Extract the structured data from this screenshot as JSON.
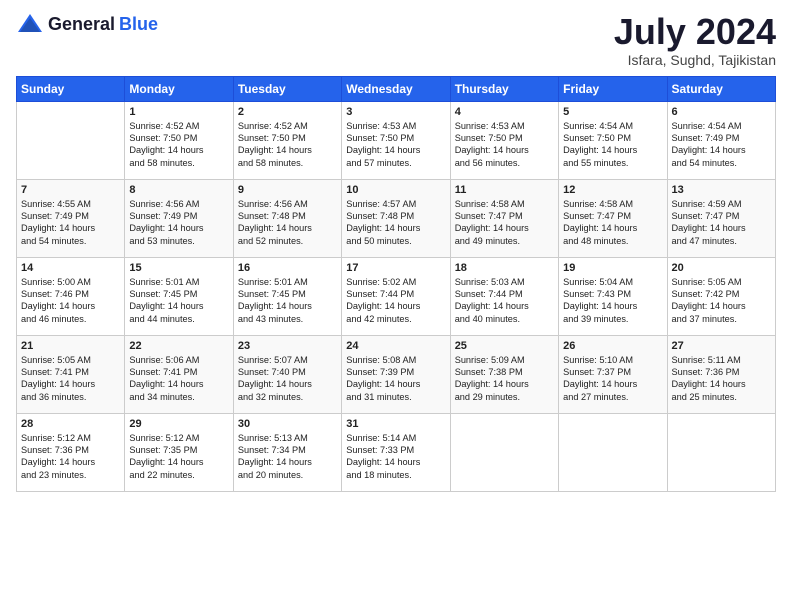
{
  "logo": {
    "general": "General",
    "blue": "Blue"
  },
  "header": {
    "month": "July 2024",
    "location": "Isfara, Sughd, Tajikistan"
  },
  "weekdays": [
    "Sunday",
    "Monday",
    "Tuesday",
    "Wednesday",
    "Thursday",
    "Friday",
    "Saturday"
  ],
  "weeks": [
    [
      {
        "day": "",
        "sunrise": "",
        "sunset": "",
        "daylight": ""
      },
      {
        "day": "1",
        "sunrise": "Sunrise: 4:52 AM",
        "sunset": "Sunset: 7:50 PM",
        "daylight": "Daylight: 14 hours and 58 minutes."
      },
      {
        "day": "2",
        "sunrise": "Sunrise: 4:52 AM",
        "sunset": "Sunset: 7:50 PM",
        "daylight": "Daylight: 14 hours and 58 minutes."
      },
      {
        "day": "3",
        "sunrise": "Sunrise: 4:53 AM",
        "sunset": "Sunset: 7:50 PM",
        "daylight": "Daylight: 14 hours and 57 minutes."
      },
      {
        "day": "4",
        "sunrise": "Sunrise: 4:53 AM",
        "sunset": "Sunset: 7:50 PM",
        "daylight": "Daylight: 14 hours and 56 minutes."
      },
      {
        "day": "5",
        "sunrise": "Sunrise: 4:54 AM",
        "sunset": "Sunset: 7:50 PM",
        "daylight": "Daylight: 14 hours and 55 minutes."
      },
      {
        "day": "6",
        "sunrise": "Sunrise: 4:54 AM",
        "sunset": "Sunset: 7:49 PM",
        "daylight": "Daylight: 14 hours and 54 minutes."
      }
    ],
    [
      {
        "day": "7",
        "sunrise": "Sunrise: 4:55 AM",
        "sunset": "Sunset: 7:49 PM",
        "daylight": "Daylight: 14 hours and 54 minutes."
      },
      {
        "day": "8",
        "sunrise": "Sunrise: 4:56 AM",
        "sunset": "Sunset: 7:49 PM",
        "daylight": "Daylight: 14 hours and 53 minutes."
      },
      {
        "day": "9",
        "sunrise": "Sunrise: 4:56 AM",
        "sunset": "Sunset: 7:48 PM",
        "daylight": "Daylight: 14 hours and 52 minutes."
      },
      {
        "day": "10",
        "sunrise": "Sunrise: 4:57 AM",
        "sunset": "Sunset: 7:48 PM",
        "daylight": "Daylight: 14 hours and 50 minutes."
      },
      {
        "day": "11",
        "sunrise": "Sunrise: 4:58 AM",
        "sunset": "Sunset: 7:47 PM",
        "daylight": "Daylight: 14 hours and 49 minutes."
      },
      {
        "day": "12",
        "sunrise": "Sunrise: 4:58 AM",
        "sunset": "Sunset: 7:47 PM",
        "daylight": "Daylight: 14 hours and 48 minutes."
      },
      {
        "day": "13",
        "sunrise": "Sunrise: 4:59 AM",
        "sunset": "Sunset: 7:47 PM",
        "daylight": "Daylight: 14 hours and 47 minutes."
      }
    ],
    [
      {
        "day": "14",
        "sunrise": "Sunrise: 5:00 AM",
        "sunset": "Sunset: 7:46 PM",
        "daylight": "Daylight: 14 hours and 46 minutes."
      },
      {
        "day": "15",
        "sunrise": "Sunrise: 5:01 AM",
        "sunset": "Sunset: 7:45 PM",
        "daylight": "Daylight: 14 hours and 44 minutes."
      },
      {
        "day": "16",
        "sunrise": "Sunrise: 5:01 AM",
        "sunset": "Sunset: 7:45 PM",
        "daylight": "Daylight: 14 hours and 43 minutes."
      },
      {
        "day": "17",
        "sunrise": "Sunrise: 5:02 AM",
        "sunset": "Sunset: 7:44 PM",
        "daylight": "Daylight: 14 hours and 42 minutes."
      },
      {
        "day": "18",
        "sunrise": "Sunrise: 5:03 AM",
        "sunset": "Sunset: 7:44 PM",
        "daylight": "Daylight: 14 hours and 40 minutes."
      },
      {
        "day": "19",
        "sunrise": "Sunrise: 5:04 AM",
        "sunset": "Sunset: 7:43 PM",
        "daylight": "Daylight: 14 hours and 39 minutes."
      },
      {
        "day": "20",
        "sunrise": "Sunrise: 5:05 AM",
        "sunset": "Sunset: 7:42 PM",
        "daylight": "Daylight: 14 hours and 37 minutes."
      }
    ],
    [
      {
        "day": "21",
        "sunrise": "Sunrise: 5:05 AM",
        "sunset": "Sunset: 7:41 PM",
        "daylight": "Daylight: 14 hours and 36 minutes."
      },
      {
        "day": "22",
        "sunrise": "Sunrise: 5:06 AM",
        "sunset": "Sunset: 7:41 PM",
        "daylight": "Daylight: 14 hours and 34 minutes."
      },
      {
        "day": "23",
        "sunrise": "Sunrise: 5:07 AM",
        "sunset": "Sunset: 7:40 PM",
        "daylight": "Daylight: 14 hours and 32 minutes."
      },
      {
        "day": "24",
        "sunrise": "Sunrise: 5:08 AM",
        "sunset": "Sunset: 7:39 PM",
        "daylight": "Daylight: 14 hours and 31 minutes."
      },
      {
        "day": "25",
        "sunrise": "Sunrise: 5:09 AM",
        "sunset": "Sunset: 7:38 PM",
        "daylight": "Daylight: 14 hours and 29 minutes."
      },
      {
        "day": "26",
        "sunrise": "Sunrise: 5:10 AM",
        "sunset": "Sunset: 7:37 PM",
        "daylight": "Daylight: 14 hours and 27 minutes."
      },
      {
        "day": "27",
        "sunrise": "Sunrise: 5:11 AM",
        "sunset": "Sunset: 7:36 PM",
        "daylight": "Daylight: 14 hours and 25 minutes."
      }
    ],
    [
      {
        "day": "28",
        "sunrise": "Sunrise: 5:12 AM",
        "sunset": "Sunset: 7:36 PM",
        "daylight": "Daylight: 14 hours and 23 minutes."
      },
      {
        "day": "29",
        "sunrise": "Sunrise: 5:12 AM",
        "sunset": "Sunset: 7:35 PM",
        "daylight": "Daylight: 14 hours and 22 minutes."
      },
      {
        "day": "30",
        "sunrise": "Sunrise: 5:13 AM",
        "sunset": "Sunset: 7:34 PM",
        "daylight": "Daylight: 14 hours and 20 minutes."
      },
      {
        "day": "31",
        "sunrise": "Sunrise: 5:14 AM",
        "sunset": "Sunset: 7:33 PM",
        "daylight": "Daylight: 14 hours and 18 minutes."
      },
      {
        "day": "",
        "sunrise": "",
        "sunset": "",
        "daylight": ""
      },
      {
        "day": "",
        "sunrise": "",
        "sunset": "",
        "daylight": ""
      },
      {
        "day": "",
        "sunrise": "",
        "sunset": "",
        "daylight": ""
      }
    ]
  ]
}
